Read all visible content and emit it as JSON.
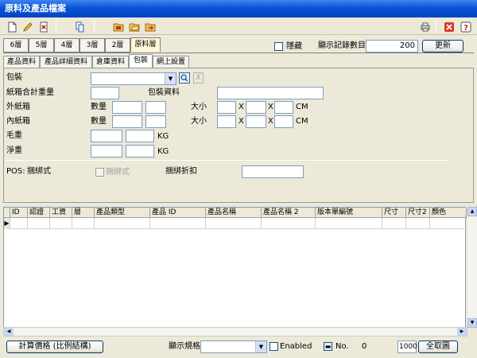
{
  "window": {
    "title": "原料及產品檔案"
  },
  "layer_tabs": [
    "6層",
    "5層",
    "4層",
    "3層",
    "2層",
    "原料層"
  ],
  "header": {
    "hide_label": "隱藏",
    "record_count_label": "顯示記錄數目",
    "record_count_value": "200",
    "refresh_label": "更新"
  },
  "sub_tabs": [
    "產品資料",
    "產品詳細資料",
    "倉庫資料",
    "包裝",
    "網上設置"
  ],
  "form": {
    "packaging_label": "包裝",
    "carton_total_weight_label": "紙箱合計重量",
    "packaging_info_label": "包裝資料",
    "outer_carton_label": "外紙箱",
    "inner_carton_label": "內紙箱",
    "qty_label": "數量",
    "size_label": "大小",
    "x_label": "X",
    "cm_label": "CM",
    "gross_weight_label": "毛重",
    "net_weight_label": "淨重",
    "kg_label": "KG",
    "pos_label": "POS:",
    "bundle_style_label": "捆綁式",
    "bundle_checkbox_label": "捆綁式",
    "bundle_discount_label": "捆綁折扣"
  },
  "grid": {
    "columns": [
      "ID",
      "認證",
      "工資",
      "層",
      "產品類型",
      "產品 ID",
      "產品名稱",
      "產品名稱 2",
      "版本單編號",
      "尺寸",
      "尺寸2",
      "顏色"
    ]
  },
  "bottom": {
    "calc_price_label": "計算價格 (比例結構)",
    "display_spec_label": "顯示規格",
    "enabled_label": "Enabled",
    "no_label": "No.",
    "no_value": "0",
    "page_size_value": "1000",
    "fetch_all_label": "全取圖"
  },
  "colors": {
    "title_bar": "#0A54D8",
    "active_layer_tab": "#FFF7D6",
    "window_bg": "#ECE9D8"
  }
}
